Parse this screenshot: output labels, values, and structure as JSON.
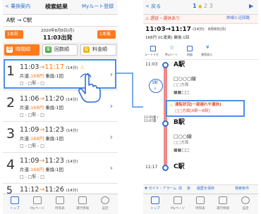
{
  "left": {
    "header": {
      "back_label": "乗換案内",
      "title": "検索結果",
      "register_label": "Myルート登録"
    },
    "route": {
      "text": "A駅 → C駅"
    },
    "date": {
      "prev_label": "1本前",
      "next_label": "1本後",
      "date_text": "2020年8月8日(月)",
      "time_text": "11:03出発"
    },
    "sort": {
      "time_label": "時間順",
      "transfer_label": "回数順",
      "fare_label": "料金順",
      "time_badge": "早",
      "transfer_badge": "楽",
      "fare_badge": "安"
    },
    "results": [
      {
        "num": "1",
        "dep": "11:03",
        "arr": "11:17",
        "dur": "(14分)",
        "fare": "168円",
        "transfers": "乗換:1回",
        "lines": "□ - □駅 - □",
        "warning": true
      },
      {
        "num": "2",
        "dep": "11:06",
        "arr": "11:20",
        "dur": "(14分)",
        "fare": "168円",
        "transfers": "乗換:1回",
        "lines": "□ - □駅 - □",
        "warning": false
      },
      {
        "num": "3",
        "dep": "11:09",
        "arr": "11:23",
        "dur": "(14分)",
        "fare": "168円",
        "transfers": "乗換:1回",
        "lines": "□ - □駅 - □",
        "warning": false
      },
      {
        "num": "4",
        "dep": "11:09",
        "arr": "11:23",
        "dur": "(14分)",
        "fare": "168円",
        "transfers": "乗換:1回",
        "lines": "□ - □駅 - □",
        "warning": false
      },
      {
        "num": "5",
        "dep": "11:12",
        "arr": "11:26",
        "dur": "(14分)",
        "fare": "168円",
        "transfers": "乗換:1回",
        "lines": "□ - □駅 - □",
        "warning": false
      }
    ],
    "tabs": [
      "トップ",
      "Myページ",
      "時刻表",
      "運行情報",
      "設定"
    ]
  },
  "right": {
    "header": {
      "back_label": "戻る",
      "pages": [
        "1",
        "2",
        "3"
      ]
    },
    "alert": {
      "text": "遅延・運休あり",
      "detail_link": "詳細と迂回路"
    },
    "summary": {
      "time": "11:03→11:17",
      "duration": "(14分)",
      "date": "8月8日(月)",
      "fare_detail": "168円 (IC運賃)  乗換:1回"
    },
    "actions": [
      "ルートメモ",
      "Myルート",
      "地図",
      "運賃表示"
    ],
    "stations": [
      {
        "name": "A駅",
        "time": "11:03"
      },
      {
        "name": "B駅",
        "time": "11:05着 / 11:07発"
      },
      {
        "name": "C駅",
        "time": "11:17"
      }
    ],
    "lines": {
      "line1": "□○○○線",
      "line1_dir": "□□方面",
      "stops": "3駅",
      "line2": "□○○線",
      "line2_dir": "□□方面",
      "gap_label": "□□線"
    },
    "status": {
      "title": "運転状況[一部遅れや運休]",
      "sub": "□□方面[A駅〜B駅]"
    },
    "footer": {
      "alarm": "ガイド・アラーム",
      "prev": "前",
      "next": "後",
      "history": "履歴を保存",
      "search": "検索条件"
    },
    "tabs": [
      "トップ",
      "Myページ",
      "時刻表",
      "運行情報",
      "設定"
    ]
  },
  "colors": {
    "accent_blue": "#2f6fd2",
    "orange": "#ff7a1a",
    "highlight": "#4a8fe7",
    "alert_red": "#e04a2f",
    "warning_yellow": "#f5b400"
  }
}
